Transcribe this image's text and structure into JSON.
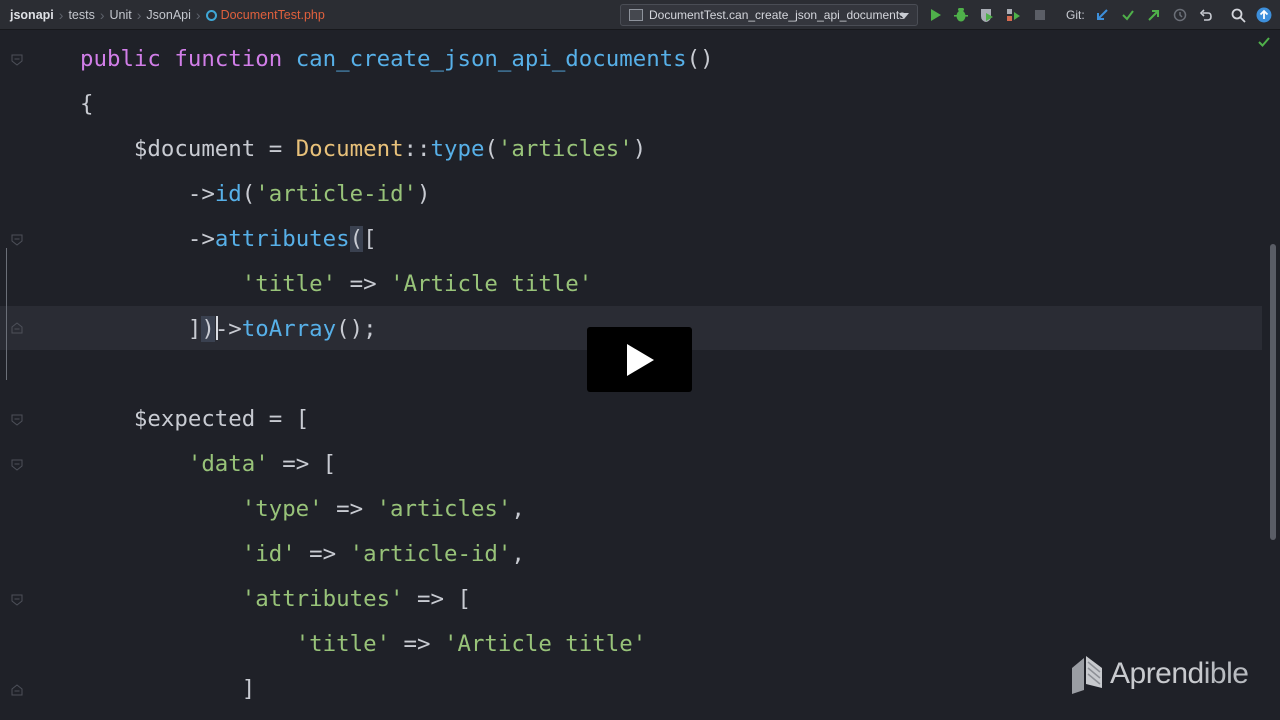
{
  "breadcrumb": {
    "items": [
      "jsonapi",
      "tests",
      "Unit",
      "JsonApi"
    ],
    "file": "DocumentTest.php"
  },
  "run_config": {
    "label": "DocumentTest.can_create_json_api_documents"
  },
  "toolbar": {
    "git_label": "Git:",
    "icons": [
      "run-icon",
      "debug-icon",
      "coverage-icon",
      "profile-icon",
      "stop-icon",
      "git-update-icon",
      "git-commit-icon",
      "git-push-icon",
      "history-icon",
      "rollback-icon",
      "search-icon",
      "ide-update-icon"
    ]
  },
  "code": {
    "lines": [
      {
        "tokens": [
          [
            "kw",
            "public "
          ],
          [
            "kw",
            "function "
          ],
          [
            "fn",
            "can_create_json_api_documents"
          ],
          [
            "pun",
            "()"
          ]
        ]
      },
      {
        "tokens": [
          [
            "pun",
            "{"
          ]
        ]
      },
      {
        "tokens": [
          [
            "var",
            "    $document "
          ],
          [
            "pun",
            "= "
          ],
          [
            "cls",
            "Document"
          ],
          [
            "pun",
            "::"
          ],
          [
            "fn",
            "type"
          ],
          [
            "pun",
            "("
          ],
          [
            "str",
            "'articles'"
          ],
          [
            "pun",
            ")"
          ]
        ]
      },
      {
        "tokens": [
          [
            "pun",
            "        ->"
          ],
          [
            "fn",
            "id"
          ],
          [
            "pun",
            "("
          ],
          [
            "str",
            "'article-id'"
          ],
          [
            "pun",
            ")"
          ]
        ]
      },
      {
        "tokens": [
          [
            "pun",
            "        ->"
          ],
          [
            "fn",
            "attributes"
          ],
          [
            "hl",
            "("
          ],
          [
            "pun",
            "["
          ]
        ]
      },
      {
        "tokens": [
          [
            "pun",
            "            "
          ],
          [
            "str",
            "'title'"
          ],
          [
            "pun",
            " => "
          ],
          [
            "str",
            "'Article title'"
          ]
        ]
      },
      {
        "tokens": [
          [
            "pun",
            "        ]"
          ],
          [
            "hl",
            ")"
          ],
          [
            "pun",
            "->"
          ],
          [
            "fn",
            "toArray"
          ],
          [
            "pun",
            "();"
          ]
        ]
      },
      {
        "tokens": [
          [
            "pun",
            ""
          ]
        ]
      },
      {
        "tokens": [
          [
            "var",
            "    $expected "
          ],
          [
            "pun",
            "= ["
          ]
        ]
      },
      {
        "tokens": [
          [
            "pun",
            "        "
          ],
          [
            "str",
            "'data'"
          ],
          [
            "pun",
            " => ["
          ]
        ]
      },
      {
        "tokens": [
          [
            "pun",
            "            "
          ],
          [
            "str",
            "'type'"
          ],
          [
            "pun",
            " => "
          ],
          [
            "str",
            "'articles'"
          ],
          [
            "pun",
            ","
          ]
        ]
      },
      {
        "tokens": [
          [
            "pun",
            "            "
          ],
          [
            "str",
            "'id'"
          ],
          [
            "pun",
            " => "
          ],
          [
            "str",
            "'article-id'"
          ],
          [
            "pun",
            ","
          ]
        ]
      },
      {
        "tokens": [
          [
            "pun",
            "            "
          ],
          [
            "str",
            "'attributes'"
          ],
          [
            "pun",
            " => ["
          ]
        ]
      },
      {
        "tokens": [
          [
            "pun",
            "                "
          ],
          [
            "str",
            "'title'"
          ],
          [
            "pun",
            " => "
          ],
          [
            "str",
            "'Article title'"
          ]
        ]
      },
      {
        "tokens": [
          [
            "pun",
            "            ]"
          ]
        ]
      }
    ]
  },
  "watermark": {
    "text_a": "Aprend",
    "text_b": "ible"
  }
}
